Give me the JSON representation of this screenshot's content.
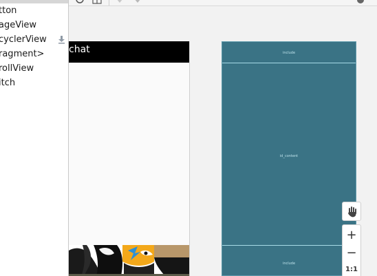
{
  "palette": {
    "items": [
      {
        "label": "tton"
      },
      {
        "label": "ageView"
      },
      {
        "label": "cyclerView",
        "downloadable": true
      },
      {
        "label": "ragment>"
      },
      {
        "label": "rollView"
      },
      {
        "label": "itch"
      }
    ]
  },
  "design": {
    "appbar_title": "chat"
  },
  "blueprint": {
    "top_label": "include",
    "center_label": "id_content",
    "bottom_label": "include"
  },
  "controls": {
    "zoom_in": "+",
    "zoom_out": "−",
    "actual_size": "1:1"
  },
  "colors": {
    "blueprint_bg": "#3a7385",
    "appbar_bg": "#000000"
  },
  "icons": [
    "download-icon",
    "pan-hand-icon",
    "zoom-in-icon",
    "zoom-out-icon",
    "help-icon"
  ]
}
